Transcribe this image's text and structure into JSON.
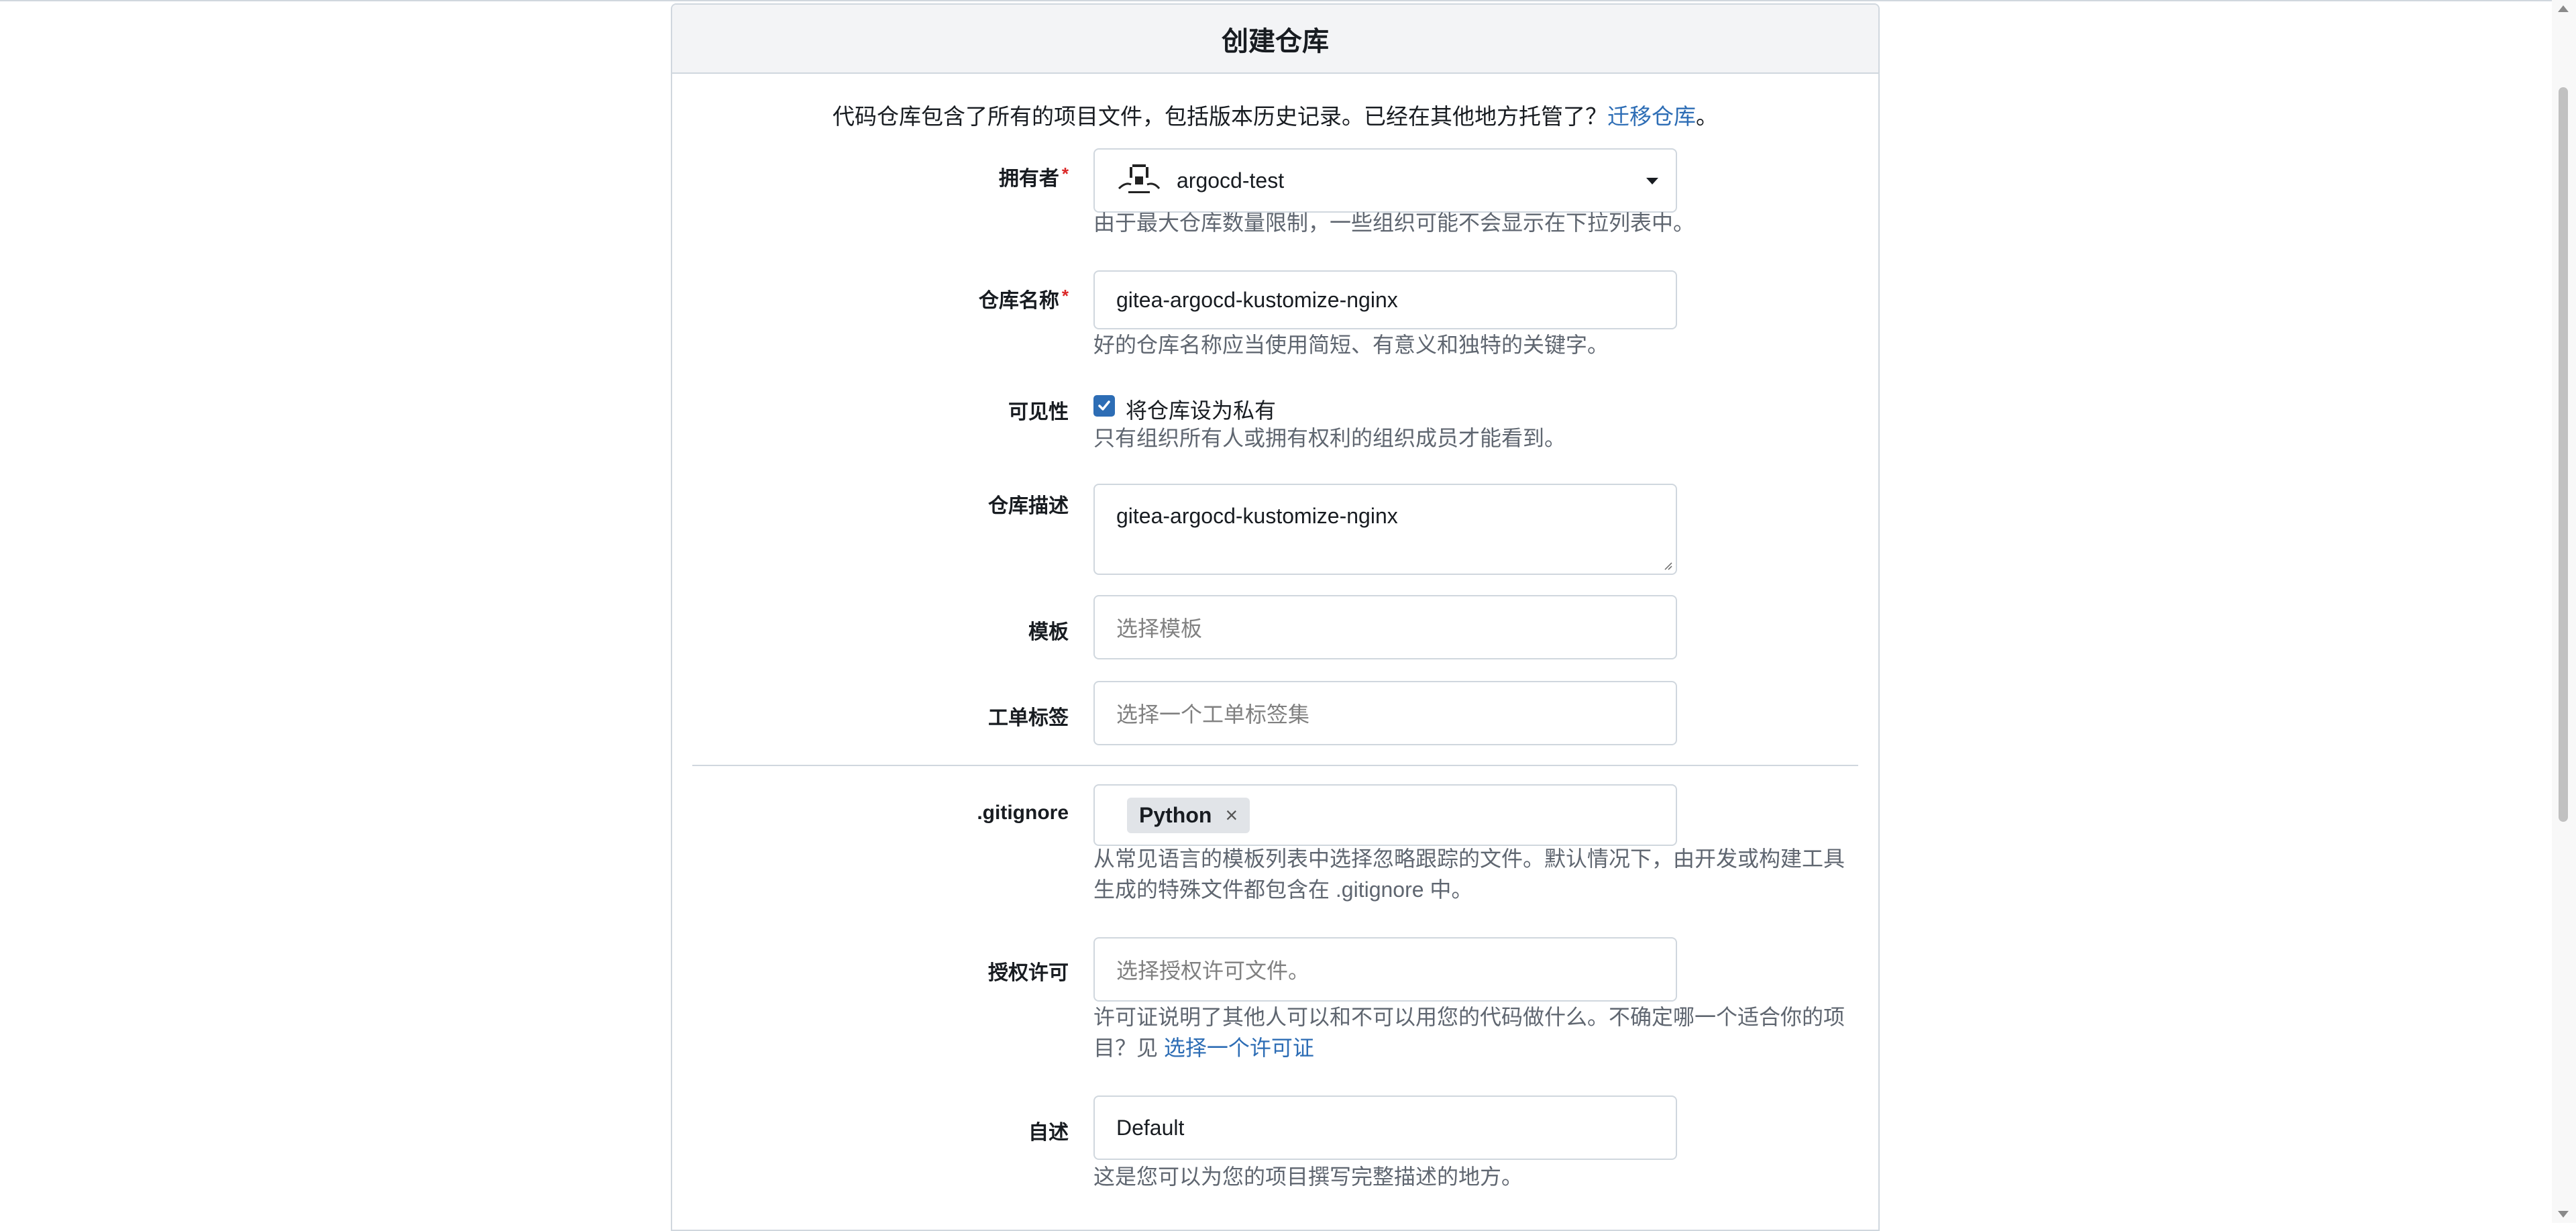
{
  "header": {
    "title": "创建仓库"
  },
  "intro": {
    "text": "代码仓库包含了所有的项目文件，包括版本历史记录。已经在其他地方托管了？",
    "link": "迁移仓库",
    "suffix": "。"
  },
  "owner": {
    "label": "拥有者",
    "required_mark": "*",
    "value": "argocd-test",
    "icon": "org-avatar-icon",
    "help": "由于最大仓库数量限制，一些组织可能不会显示在下拉列表中。"
  },
  "repo_name": {
    "label": "仓库名称",
    "required_mark": "*",
    "value": "gitea-argocd-kustomize-nginx",
    "help": "好的仓库名称应当使用简短、有意义和独特的关键字。"
  },
  "visibility": {
    "label": "可见性",
    "checkbox_label": "将仓库设为私有",
    "checked": true,
    "help": "只有组织所有人或拥有权利的组织成员才能看到。"
  },
  "description": {
    "label": "仓库描述",
    "value": "gitea-argocd-kustomize-nginx"
  },
  "template": {
    "label": "模板",
    "placeholder": "选择模板"
  },
  "issue_labels": {
    "label": "工单标签",
    "placeholder": "选择一个工单标签集"
  },
  "gitignore": {
    "label": ".gitignore",
    "tag": "Python",
    "tag_remove": "×",
    "help": "从常见语言的模板列表中选择忽略跟踪的文件。默认情况下，由开发或构建工具生成的特殊文件都包含在 .gitignore 中。"
  },
  "license": {
    "label": "授权许可",
    "placeholder": "选择授权许可文件。",
    "help": "许可证说明了其他人可以和不可以用您的代码做什么。不确定哪一个适合你的项目？见 ",
    "help_link": "选择一个许可证"
  },
  "readme": {
    "label": "自述",
    "value": "Default",
    "help": "这是您可以为您的项目撰写完整描述的地方。"
  },
  "colors": {
    "accent": "#2d6db5",
    "border": "#d0d7de",
    "required": "#db2828"
  }
}
